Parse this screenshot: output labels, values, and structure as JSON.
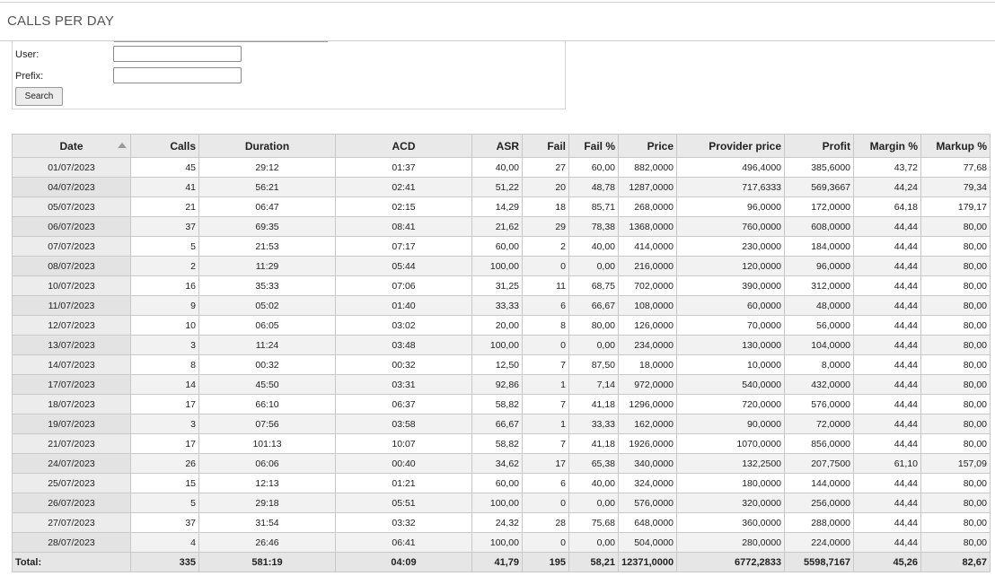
{
  "page": {
    "title": "CALLS PER DAY"
  },
  "filters": {
    "user_label": "User:",
    "user_value": "",
    "prefix_label": "Prefix:",
    "prefix_value": "",
    "search_label": "Search"
  },
  "table": {
    "columns": [
      "Date",
      "Calls",
      "Duration",
      "ACD",
      "ASR",
      "Fail",
      "Fail %",
      "Price",
      "Provider price",
      "Profit",
      "Margin %",
      "Markup %"
    ],
    "sort_icon": "sort-up-icon",
    "rows": [
      [
        "01/07/2023",
        "45",
        "29:12",
        "01:37",
        "40,00",
        "27",
        "60,00",
        "882,0000",
        "496,4000",
        "385,6000",
        "43,72",
        "77,68"
      ],
      [
        "04/07/2023",
        "41",
        "56:21",
        "02:41",
        "51,22",
        "20",
        "48,78",
        "1287,0000",
        "717,6333",
        "569,3667",
        "44,24",
        "79,34"
      ],
      [
        "05/07/2023",
        "21",
        "06:47",
        "02:15",
        "14,29",
        "18",
        "85,71",
        "268,0000",
        "96,0000",
        "172,0000",
        "64,18",
        "179,17"
      ],
      [
        "06/07/2023",
        "37",
        "69:35",
        "08:41",
        "21,62",
        "29",
        "78,38",
        "1368,0000",
        "760,0000",
        "608,0000",
        "44,44",
        "80,00"
      ],
      [
        "07/07/2023",
        "5",
        "21:53",
        "07:17",
        "60,00",
        "2",
        "40,00",
        "414,0000",
        "230,0000",
        "184,0000",
        "44,44",
        "80,00"
      ],
      [
        "08/07/2023",
        "2",
        "11:29",
        "05:44",
        "100,00",
        "0",
        "0,00",
        "216,0000",
        "120,0000",
        "96,0000",
        "44,44",
        "80,00"
      ],
      [
        "10/07/2023",
        "16",
        "35:33",
        "07:06",
        "31,25",
        "11",
        "68,75",
        "702,0000",
        "390,0000",
        "312,0000",
        "44,44",
        "80,00"
      ],
      [
        "11/07/2023",
        "9",
        "05:02",
        "01:40",
        "33,33",
        "6",
        "66,67",
        "108,0000",
        "60,0000",
        "48,0000",
        "44,44",
        "80,00"
      ],
      [
        "12/07/2023",
        "10",
        "06:05",
        "03:02",
        "20,00",
        "8",
        "80,00",
        "126,0000",
        "70,0000",
        "56,0000",
        "44,44",
        "80,00"
      ],
      [
        "13/07/2023",
        "3",
        "11:24",
        "03:48",
        "100,00",
        "0",
        "0,00",
        "234,0000",
        "130,0000",
        "104,0000",
        "44,44",
        "80,00"
      ],
      [
        "14/07/2023",
        "8",
        "00:32",
        "00:32",
        "12,50",
        "7",
        "87,50",
        "18,0000",
        "10,0000",
        "8,0000",
        "44,44",
        "80,00"
      ],
      [
        "17/07/2023",
        "14",
        "45:50",
        "03:31",
        "92,86",
        "1",
        "7,14",
        "972,0000",
        "540,0000",
        "432,0000",
        "44,44",
        "80,00"
      ],
      [
        "18/07/2023",
        "17",
        "66:10",
        "06:37",
        "58,82",
        "7",
        "41,18",
        "1296,0000",
        "720,0000",
        "576,0000",
        "44,44",
        "80,00"
      ],
      [
        "19/07/2023",
        "3",
        "07:56",
        "03:58",
        "66,67",
        "1",
        "33,33",
        "162,0000",
        "90,0000",
        "72,0000",
        "44,44",
        "80,00"
      ],
      [
        "21/07/2023",
        "17",
        "101:13",
        "10:07",
        "58,82",
        "7",
        "41,18",
        "1926,0000",
        "1070,0000",
        "856,0000",
        "44,44",
        "80,00"
      ],
      [
        "24/07/2023",
        "26",
        "06:06",
        "00:40",
        "34,62",
        "17",
        "65,38",
        "340,0000",
        "132,2500",
        "207,7500",
        "61,10",
        "157,09"
      ],
      [
        "25/07/2023",
        "15",
        "12:13",
        "01:21",
        "60,00",
        "6",
        "40,00",
        "324,0000",
        "180,0000",
        "144,0000",
        "44,44",
        "80,00"
      ],
      [
        "26/07/2023",
        "5",
        "29:18",
        "05:51",
        "100,00",
        "0",
        "0,00",
        "576,0000",
        "320,0000",
        "256,0000",
        "44,44",
        "80,00"
      ],
      [
        "27/07/2023",
        "37",
        "31:54",
        "03:32",
        "24,32",
        "28",
        "75,68",
        "648,0000",
        "360,0000",
        "288,0000",
        "44,44",
        "80,00"
      ],
      [
        "28/07/2023",
        "4",
        "26:46",
        "06:41",
        "100,00",
        "0",
        "0,00",
        "504,0000",
        "280,0000",
        "224,0000",
        "44,44",
        "80,00"
      ]
    ],
    "totals": [
      "Total:",
      "335",
      "581:19",
      "04:09",
      "41,79",
      "195",
      "58,21",
      "12371,0000",
      "6772,2833",
      "5598,7167",
      "45,26",
      "82,67"
    ]
  }
}
